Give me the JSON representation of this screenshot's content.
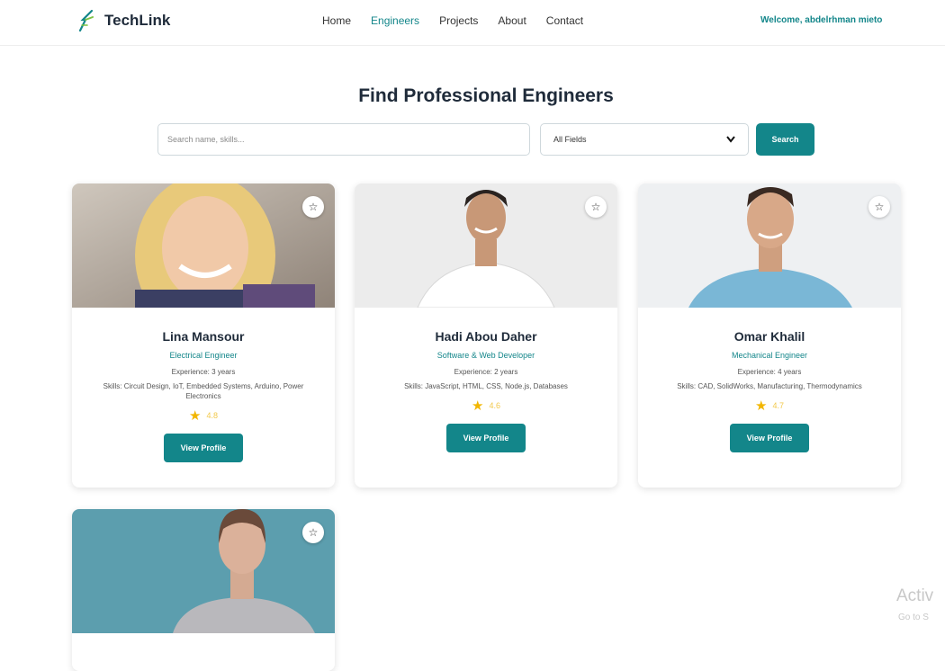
{
  "header": {
    "logo_text": "TechLink",
    "nav": [
      {
        "label": "Home",
        "active": false
      },
      {
        "label": "Engineers",
        "active": true
      },
      {
        "label": "Projects",
        "active": false
      },
      {
        "label": "About",
        "active": false
      },
      {
        "label": "Contact",
        "active": false
      }
    ],
    "welcome": "Welcome, abdelrhman mieto"
  },
  "main": {
    "title": "Find Professional Engineers",
    "search": {
      "placeholder": "Search name, skills..."
    },
    "field_filter": {
      "selected": "All Fields"
    },
    "search_button": "Search"
  },
  "cards": [
    {
      "name": "Lina Mansour",
      "role": "Electrical Engineer",
      "experience": "Experience: 3 years",
      "skills": "Skills: Circuit Design, IoT, Embedded Systems, Arduino, Power Electronics",
      "rating": "4.8",
      "button": "View Profile"
    },
    {
      "name": "Hadi Abou Daher",
      "role": "Software & Web Developer",
      "experience": "Experience: 2 years",
      "skills": "Skills: JavaScript, HTML, CSS, Node.js, Databases",
      "rating": "4.6",
      "button": "View Profile"
    },
    {
      "name": "Omar Khalil",
      "role": "Mechanical Engineer",
      "experience": "Experience: 4 years",
      "skills": "Skills: CAD, SolidWorks, Manufacturing, Thermodynamics",
      "rating": "4.7",
      "button": "View Profile"
    },
    {
      "name": "",
      "role": "",
      "experience": "",
      "skills": "",
      "rating": "",
      "button": ""
    }
  ],
  "watermark": {
    "title": "Activ",
    "subtitle": "Go to S"
  },
  "colors": {
    "accent": "#13868a",
    "star": "#f2b600"
  }
}
